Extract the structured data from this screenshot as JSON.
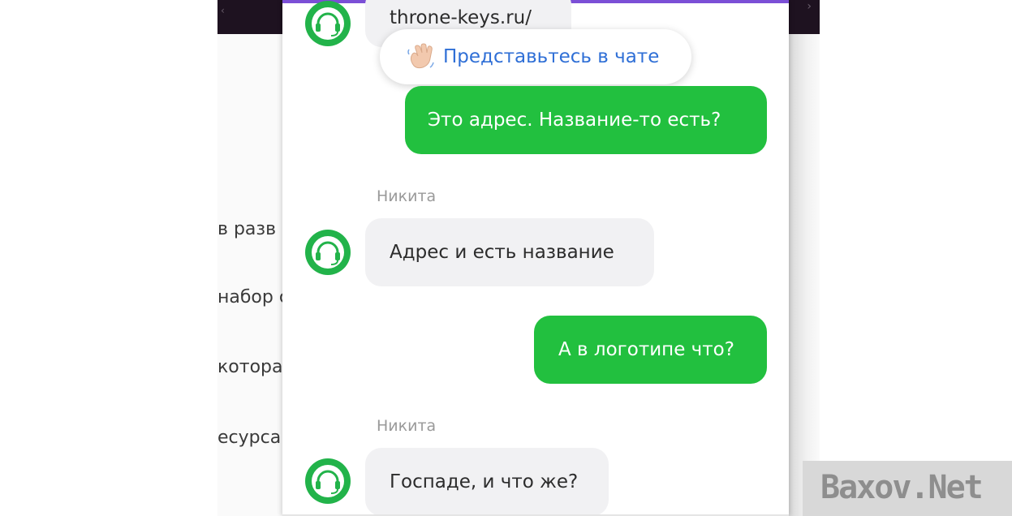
{
  "background_page": {
    "lines": [
      "в разв",
      "набор с",
      "котора",
      "есурса"
    ]
  },
  "chat": {
    "header_icon": "headset-icon",
    "prompt_pill": {
      "icon": "waving-hand-icon",
      "label": "Представьтесь в чате"
    },
    "messages": [
      {
        "direction": "in",
        "text": "throne-keys.ru/"
      },
      {
        "direction": "out",
        "text": "Это адрес. Название-то есть?"
      },
      {
        "direction": "in",
        "sender": "Никита",
        "text": "Адрес и есть название"
      },
      {
        "direction": "out",
        "text": "А в логотипе что?"
      },
      {
        "direction": "in",
        "sender": "Никита",
        "text": "Госпаде, и что же?"
      }
    ]
  },
  "watermark": {
    "text": "Baxov.Net"
  },
  "colors": {
    "accent_green": "#22c03f",
    "link_blue": "#2f6fd6",
    "topbar": "#1e1220",
    "chat_top_line": "#7b4fd6"
  }
}
